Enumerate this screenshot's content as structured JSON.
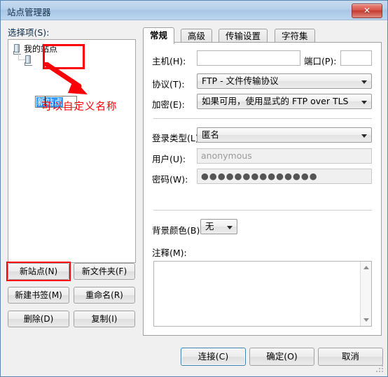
{
  "window": {
    "title": "站点管理器",
    "close_label": "✕"
  },
  "left": {
    "select_label": "选择项(S):",
    "tree": {
      "root_label": "我的站点",
      "child_edit_value": "新站点"
    },
    "buttons": [
      {
        "label": "新站点(N)"
      },
      {
        "label": "新文件夹(F)"
      },
      {
        "label": "新建书签(M)"
      },
      {
        "label": "重命名(R)"
      },
      {
        "label": "删除(D)"
      },
      {
        "label": "复制(I)"
      }
    ]
  },
  "annotations": {
    "callout_text": "可以自定义名称",
    "color": "#fb0007"
  },
  "tabs": [
    {
      "label": "常规",
      "active": true
    },
    {
      "label": "高级",
      "active": false
    },
    {
      "label": "传输设置",
      "active": false
    },
    {
      "label": "字符集",
      "active": false
    }
  ],
  "general": {
    "host_label": "主机(H):",
    "host_value": "",
    "port_label": "端口(P):",
    "port_value": "",
    "protocol_label": "协议(T):",
    "protocol_value": "FTP - 文件传输协议",
    "encryption_label": "加密(E):",
    "encryption_value": "如果可用，使用显式的 FTP over TLS",
    "logon_label": "登录类型(L):",
    "logon_value": "匿名",
    "user_label": "用户(U):",
    "user_value": "anonymous",
    "password_label": "密码(W):",
    "password_value": "●●●●●●●●●●●●●●",
    "bgcolor_label": "背景颜色(B)",
    "bgcolor_value": "无",
    "comments_label": "注释(M):",
    "comments_value": ""
  },
  "footer": {
    "connect_label": "连接(C)",
    "ok_label": "确定(O)",
    "cancel_label": "取消"
  }
}
